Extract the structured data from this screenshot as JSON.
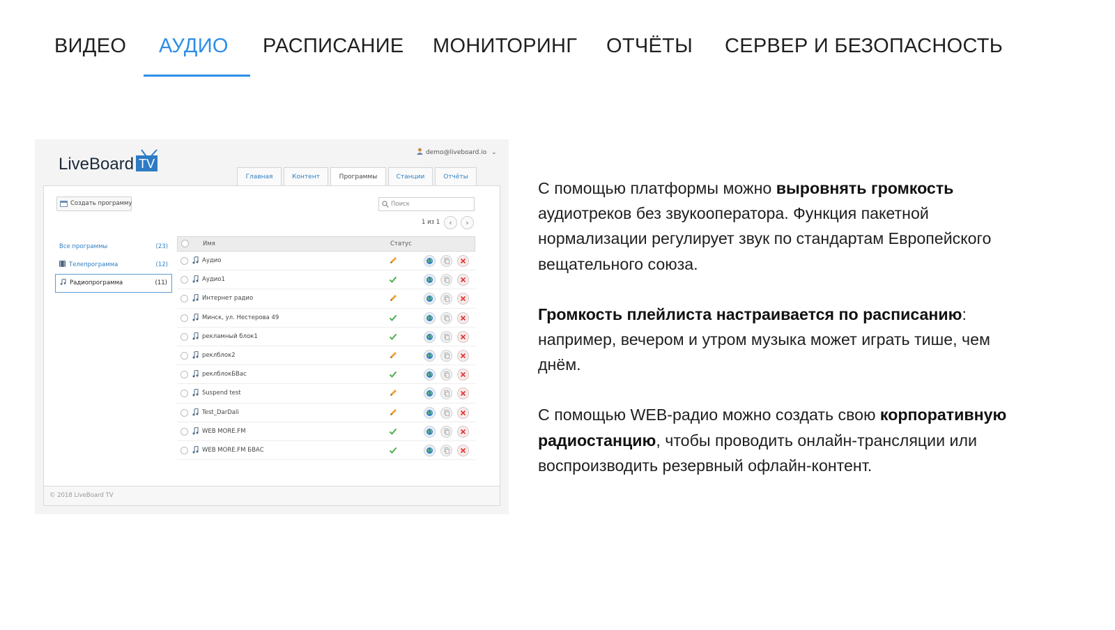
{
  "nav": {
    "tabs": [
      {
        "label": "ВИДЕО"
      },
      {
        "label": "АУДИО"
      },
      {
        "label": "РАСПИСАНИЕ"
      },
      {
        "label": "МОНИТОРИНГ"
      },
      {
        "label": "ОТЧЁТЫ"
      },
      {
        "label": "СЕРВЕР И БЕЗОПАСНОСТЬ"
      }
    ],
    "active_index": 1
  },
  "colors": {
    "accent": "#2d8ee8",
    "link": "#2f7fc1",
    "ok": "#4caf50",
    "edit": "#f0a030",
    "delete": "#e53935"
  },
  "screenshot": {
    "logo": {
      "text": "LiveBoard",
      "badge": "TV"
    },
    "user_email": "demo@liveboard.io",
    "tabs": [
      "Главная",
      "Контент",
      "Программы",
      "Станции",
      "Отчёты"
    ],
    "active_tab": "Программы",
    "create_button": "Создать программу",
    "search_placeholder": "Поиск",
    "pager": "1 из 1",
    "categories": [
      {
        "label": "Все программы",
        "count": "(23)",
        "icon": "none"
      },
      {
        "label": "Телепрограмма",
        "count": "(12)",
        "icon": "film-icon"
      },
      {
        "label": "Радиопрограмма",
        "count": "(11)",
        "icon": "music-note-icon"
      }
    ],
    "table": {
      "columns": [
        "Имя",
        "Статус"
      ],
      "rows": [
        {
          "name": "Аудио",
          "status": "edit"
        },
        {
          "name": "Аудио1",
          "status": "ok"
        },
        {
          "name": "Интернет радио",
          "status": "edit"
        },
        {
          "name": "Минск, ул. Нестерова 49",
          "status": "ok"
        },
        {
          "name": "рекламный блок1",
          "status": "ok"
        },
        {
          "name": "реклблок2",
          "status": "edit"
        },
        {
          "name": "реклблокБВас",
          "status": "ok"
        },
        {
          "name": "Suspend test",
          "status": "edit"
        },
        {
          "name": "Test_DarDali",
          "status": "edit"
        },
        {
          "name": "WEB MORE.FM",
          "status": "ok"
        },
        {
          "name": "WEB MORE.FM БВАС",
          "status": "ok"
        }
      ]
    },
    "footer": "© 2018 LiveBoard TV"
  },
  "copy": {
    "p1_a": "С помощью платформы можно ",
    "p1_b": "выровнять громкость",
    "p1_c": " аудиотреков без звукооператора. Функция пакетной нормализации регулирует звук по стандартам Европейского вещательного союза.",
    "p2_a": "Громкость плейлиста настраивается по расписанию",
    "p2_b": ": например, вечером и утром музыка может играть тише, чем днём.",
    "p3_a": "С помощью WEB-радио можно создать свою ",
    "p3_b": "корпоративную радиостанцию",
    "p3_c": ", чтобы проводить онлайн-трансляции или воспроизводить резервный офлайн-контент."
  }
}
